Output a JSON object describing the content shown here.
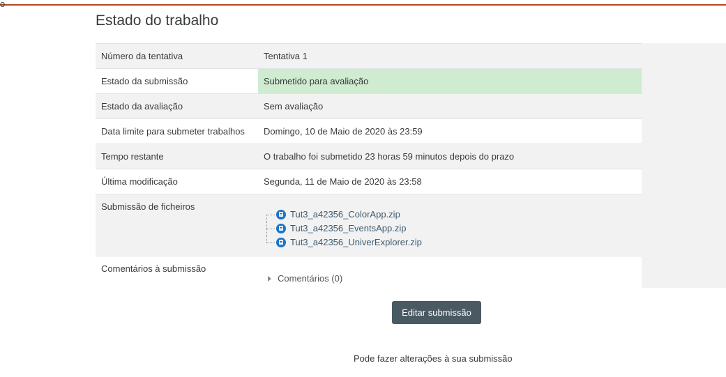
{
  "corner_fragment": "o",
  "page_title": "Estado do trabalho",
  "rows": [
    {
      "label": "Número da tentativa",
      "value": "Tentativa 1"
    },
    {
      "label": "Estado da submissão",
      "value": "Submetido para avaliação"
    },
    {
      "label": "Estado da avaliação",
      "value": "Sem avaliação"
    },
    {
      "label": "Data limite para submeter trabalhos",
      "value": "Domingo, 10 de Maio de 2020 às 23:59"
    },
    {
      "label": "Tempo restante",
      "value": "O trabalho foi submetido 23 horas 59 minutos depois do prazo"
    },
    {
      "label": "Última modificação",
      "value": "Segunda, 11 de Maio de 2020 às 23:58"
    }
  ],
  "files": {
    "label": "Submissão de ficheiros",
    "items": [
      {
        "name": "Tut3_a42356_ColorApp.zip",
        "icon": "file-archive-icon"
      },
      {
        "name": "Tut3_a42356_EventsApp.zip",
        "icon": "file-archive-icon"
      },
      {
        "name": "Tut3_a42356_UniverExplorer.zip",
        "icon": "file-archive-icon"
      }
    ]
  },
  "comments": {
    "label": "Comentários à submissão",
    "toggle": "Comentários (0)"
  },
  "edit_button": "Editar submissão",
  "hint": "Pode fazer alterações à sua submissão",
  "colors": {
    "accent_rule": "#b5461f",
    "submitted_bg": "#d0ecd0",
    "button_bg": "#4a5a63",
    "file_icon": "#1a76c9"
  }
}
